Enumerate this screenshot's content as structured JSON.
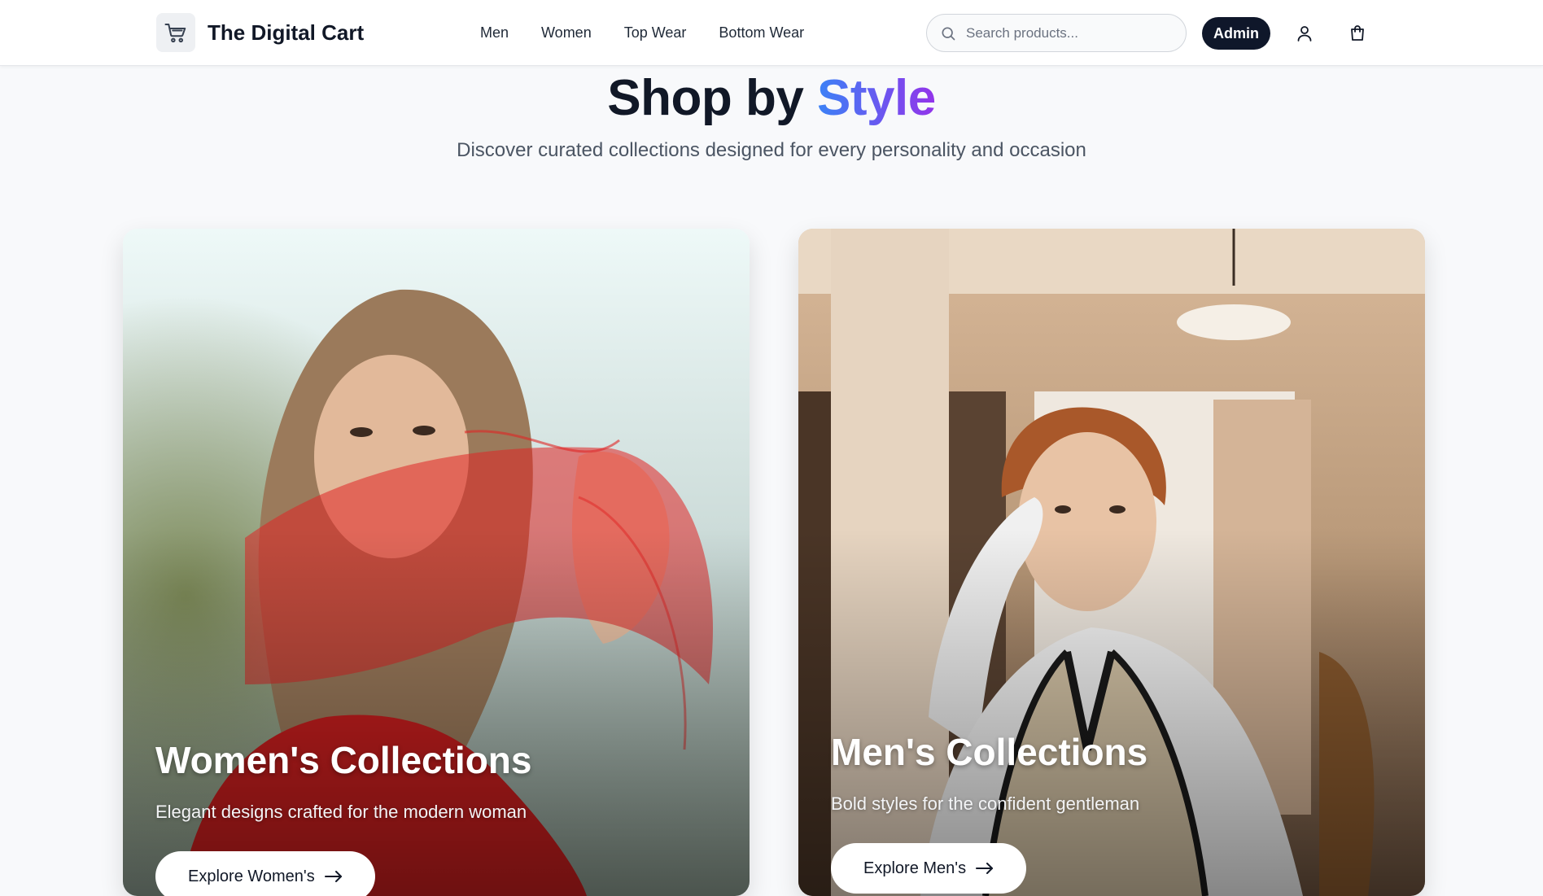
{
  "header": {
    "brand": "The Digital Cart",
    "logo_icon": "shopping-cart-icon",
    "nav": [
      {
        "label": "Men"
      },
      {
        "label": "Women"
      },
      {
        "label": "Top Wear"
      },
      {
        "label": "Bottom Wear"
      }
    ],
    "search": {
      "placeholder": "Search products...",
      "value": "",
      "icon": "search-icon"
    },
    "admin_label": "Admin",
    "user_icon": "user-icon",
    "cart_icon": "shopping-bag-icon"
  },
  "hero": {
    "title_main": "Shop by ",
    "title_accent": "Style",
    "subtitle": "Discover curated collections designed for every personality and occasion"
  },
  "collections": [
    {
      "title": "Women's Collections",
      "description": "Elegant designs crafted for the modern woman",
      "button_label": "Explore Women's",
      "button_icon": "arrow-right-icon"
    },
    {
      "title": "Men's Collections",
      "description": "Bold styles for the confident gentleman",
      "button_label": "Explore Men's",
      "button_icon": "arrow-right-icon"
    }
  ],
  "colors": {
    "accent_gradient_start": "#3b82f6",
    "accent_gradient_end": "#9333ea",
    "admin_button": "#0f172a",
    "page_background": "#f8f9fb"
  }
}
